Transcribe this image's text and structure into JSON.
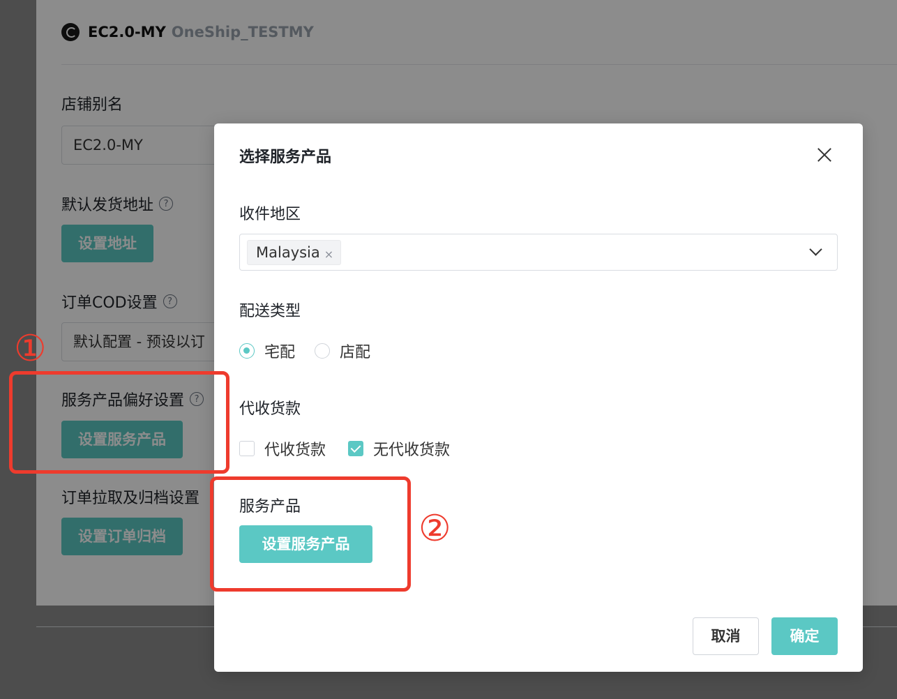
{
  "shop": {
    "name": "EC2.0-MY",
    "subtitle": "OneShip_TESTMY"
  },
  "settings": {
    "alias_label": "店铺别名",
    "alias_value": "EC2.0-MY",
    "address_label": "默认发货地址",
    "address_button": "设置地址",
    "cod_label": "订单COD设置",
    "cod_value": "默认配置 - 预设以订",
    "service_pref_label": "服务产品偏好设置",
    "service_pref_button": "设置服务产品",
    "archive_label": "订单拉取及归档设置",
    "archive_button": "设置订单归档"
  },
  "modal": {
    "title": "选择服务产品",
    "region_label": "收件地区",
    "region_tag": "Malaysia",
    "region_tag_close": "×",
    "delivery_label": "配送类型",
    "delivery_options": [
      {
        "label": "宅配",
        "selected": true
      },
      {
        "label": "店配",
        "selected": false
      }
    ],
    "cod_label": "代收货款",
    "cod_options": [
      {
        "label": "代收货款",
        "checked": false
      },
      {
        "label": "无代收货款",
        "checked": true
      }
    ],
    "service_label": "服务产品",
    "service_button": "设置服务产品",
    "cancel_button": "取消",
    "confirm_button": "确定"
  },
  "annotations": {
    "step1": "①",
    "step2": "②"
  },
  "colors": {
    "accent": "#5bc8c4",
    "annotation": "#ee3b2d"
  },
  "help_icon_glyph": "?"
}
